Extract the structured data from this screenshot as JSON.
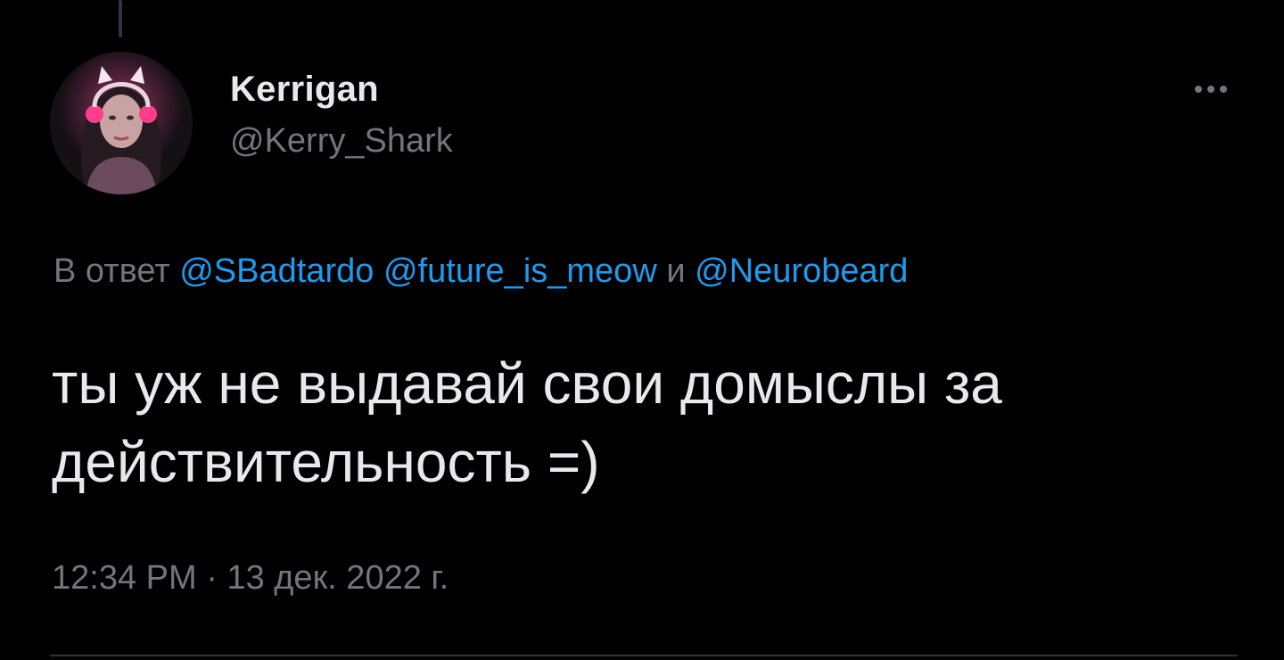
{
  "tweet": {
    "author": {
      "display_name": "Kerrigan",
      "handle": "@Kerry_Shark",
      "avatar_icon": "profile-avatar"
    },
    "more_icon": "more-horizontal-icon",
    "reply_to": {
      "prefix": "В ответ",
      "mentions": [
        "@SBadtardo",
        "@future_is_meow",
        "@Neurobeard"
      ],
      "conjunction": "и"
    },
    "text_line_1": "ты уж не выдавай свои домыслы за",
    "text_line_2": "действительность =)",
    "time": "12:34 PM",
    "separator": "·",
    "date": "13 дек. 2022 г."
  },
  "colors": {
    "background": "#000000",
    "primary_text": "#e7e9ea",
    "secondary_text": "#71767b",
    "link": "#1d9bf0",
    "divider": "#2f3336"
  }
}
